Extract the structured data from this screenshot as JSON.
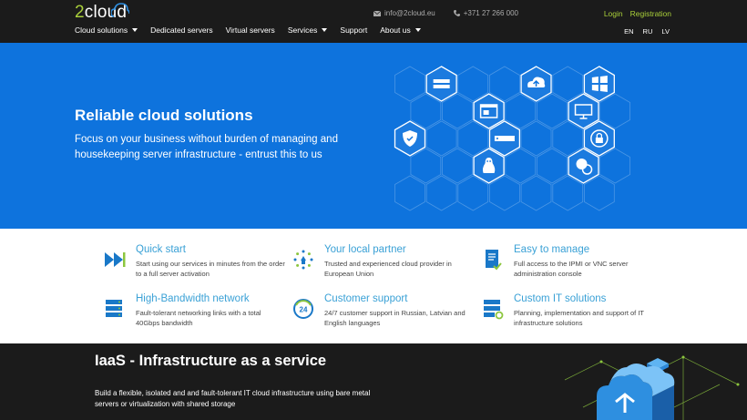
{
  "header": {
    "logo_text": "2cloud",
    "email": "info@2cloud.eu",
    "phone": "+371 27 266 000",
    "login": "Login",
    "registration": "Registration",
    "nav": [
      {
        "label": "Cloud solutions",
        "dropdown": true
      },
      {
        "label": "Dedicated servers",
        "dropdown": false
      },
      {
        "label": "Virtual servers",
        "dropdown": false
      },
      {
        "label": "Services",
        "dropdown": true
      },
      {
        "label": "Support",
        "dropdown": false
      },
      {
        "label": "About us",
        "dropdown": true
      }
    ],
    "langs": [
      "EN",
      "RU",
      "LV"
    ]
  },
  "hero": {
    "title": "Reliable cloud solutions",
    "subtitle": "Focus on your business without burden of managing and housekeeping server infrastructure - entrust this to us",
    "icons": [
      "server-icon",
      "cloud-upload-icon",
      "windows-icon",
      "browser-window-icon",
      "monitor-icon",
      "shield-icon",
      "server-rack-icon",
      "lock-icon",
      "linux-icon",
      "chat-icon"
    ]
  },
  "features": [
    {
      "title": "Quick start",
      "desc": "Start using our services in minutes from the order to a full server activation",
      "icon": "fast-forward-icon"
    },
    {
      "title": "Your local partner",
      "desc": "Trusted and experienced cloud provider in European Union",
      "icon": "eu-stars-icon"
    },
    {
      "title": "Easy to manage",
      "desc": "Full access to the IPMI or VNC server administration console",
      "icon": "document-check-icon"
    },
    {
      "title": "High-Bandwidth network",
      "desc": "Fault-tolerant networking links with a total 40Gbps bandwidth",
      "icon": "server-stack-icon"
    },
    {
      "title": "Customer support",
      "desc": "24/7 customer support in Russian, Latvian and English languages",
      "icon": "support-24-icon"
    },
    {
      "title": "Custom IT solutions",
      "desc": "Planning, implementation and support of IT infrastructure solutions",
      "icon": "server-config-icon"
    }
  ],
  "iaas": {
    "title": "IaaS - Infrastructure as a service",
    "desc": "Build a flexible, isolated and and fault-tolerant IT cloud infrastructure using bare metal servers or virtualization with shared storage"
  },
  "colors": {
    "header_bg": "#1b1b1b",
    "hero_bg": "#0e73dd",
    "accent_green": "#a9cf3a",
    "feature_title": "#3aa1d6",
    "icon_blue": "#1978c8",
    "icon_green": "#8cc63e"
  }
}
